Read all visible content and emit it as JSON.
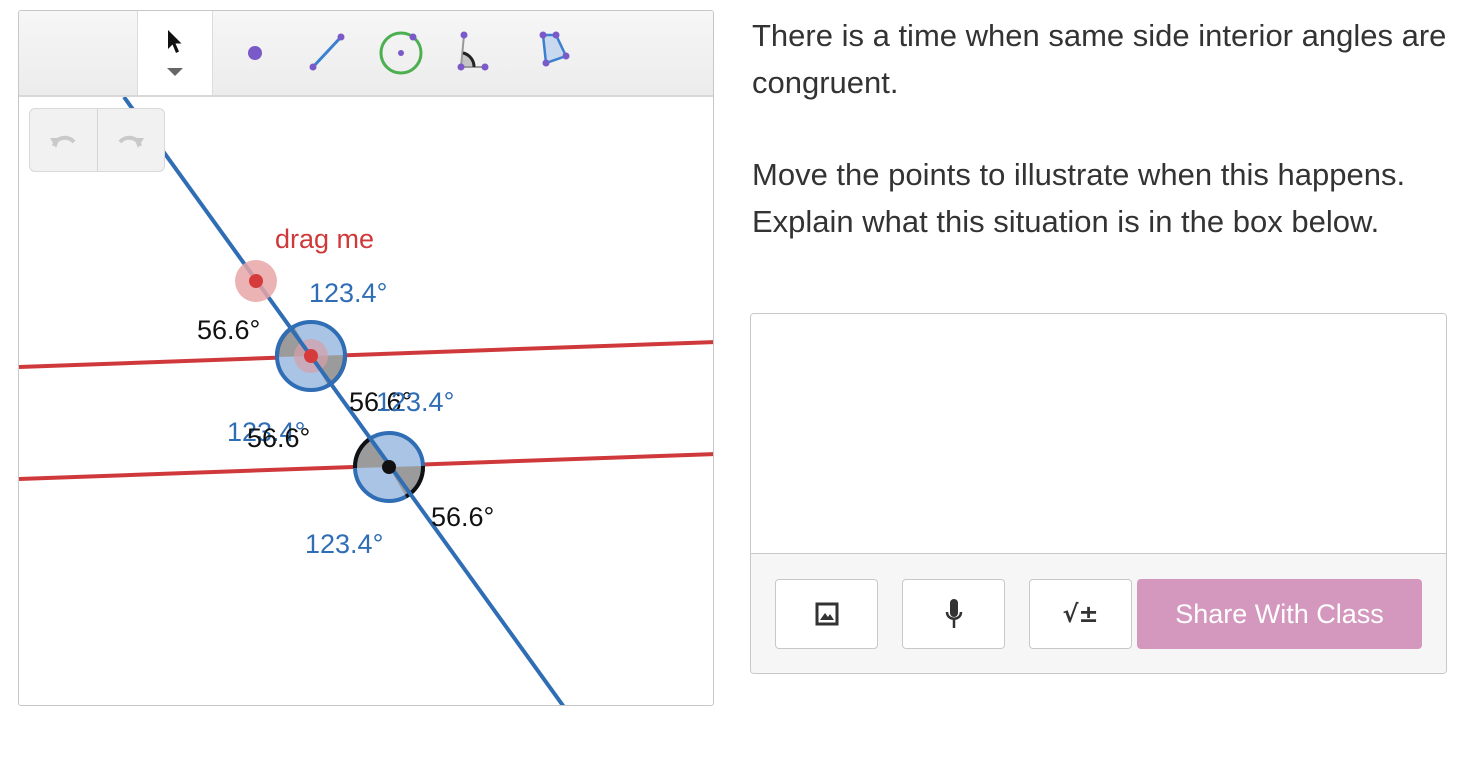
{
  "applet": {
    "toolbar": {
      "tools": [
        {
          "name": "move-tool",
          "icon": "arrow-cursor-icon",
          "selected": true
        },
        {
          "name": "point-tool",
          "icon": "point-icon"
        },
        {
          "name": "segment-tool",
          "icon": "segment-icon"
        },
        {
          "name": "circle-tool",
          "icon": "circle-icon"
        },
        {
          "name": "angle-tool",
          "icon": "angle-icon"
        },
        {
          "name": "polygon-tool",
          "icon": "polygon-icon"
        }
      ]
    },
    "undo_icon": "undo-icon",
    "redo_icon": "redo-icon",
    "drag_label": "drag me",
    "angles": {
      "top_upper_right": "123.4°",
      "top_upper_left": "56.6°",
      "top_lower_right": "56.6°",
      "top_lower_left": "123.4°",
      "bottom_upper_right": "123.4°",
      "bottom_upper_left": "56.6°",
      "bottom_lower_right": "56.6°",
      "bottom_lower_left": "123.4°"
    },
    "colors": {
      "transversal": "#2f6db5",
      "parallel_lines": "#d0393b",
      "drag_point": "#d63b3b",
      "angle_fill_blue": "#a9c4e4",
      "angle_fill_gray": "#9b9b9b",
      "label_blue": "#2f6db5",
      "label_red": "#d0393b"
    }
  },
  "prompt": {
    "paragraph1": "There is a time when same side interior angles are congruent.",
    "paragraph2": "Move the points to illustrate when this happens.  Explain what this situation is in the box below."
  },
  "response": {
    "text_value": "",
    "image_button_icon": "image-icon",
    "mic_button_icon": "microphone-icon",
    "math_button_label": "√±",
    "share_button_label": "Share With Class",
    "share_color": "#d498be"
  }
}
